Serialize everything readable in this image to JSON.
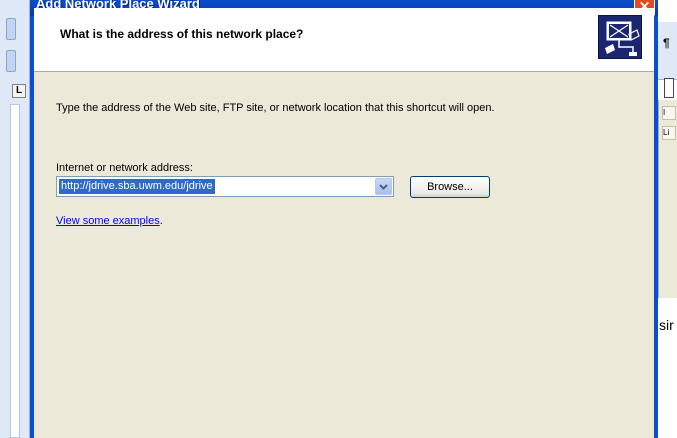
{
  "window": {
    "title": "Add Network Place Wizard",
    "close_glyph": "×"
  },
  "header": {
    "question": "What is the address of this network place?",
    "icon": "network-place-icon"
  },
  "body": {
    "instruction": "Type the address of the Web site, FTP site, or network location that this shortcut will open."
  },
  "address": {
    "label": "Internet or network address:",
    "value": "http://jdrive.sba.uwm.edu/jdrive",
    "dropdown_icon": "chevron-down-icon"
  },
  "buttons": {
    "browse_label": "Browse..."
  },
  "examples": {
    "link_text": "View some examples",
    "trailing": "."
  },
  "background_app": {
    "left_glyphs": [
      "⋮",
      "⋮"
    ],
    "ruler_tab": "L",
    "right_glyph": "¶",
    "right_text": "sir",
    "right_panel_cells": [
      "I",
      "Li"
    ]
  },
  "colors": {
    "titlebar": "#0a46c4",
    "dialog_bg": "#ece9d8",
    "selection": "#316ac5",
    "close_button": "#e24b1f",
    "link": "#0000ff"
  }
}
